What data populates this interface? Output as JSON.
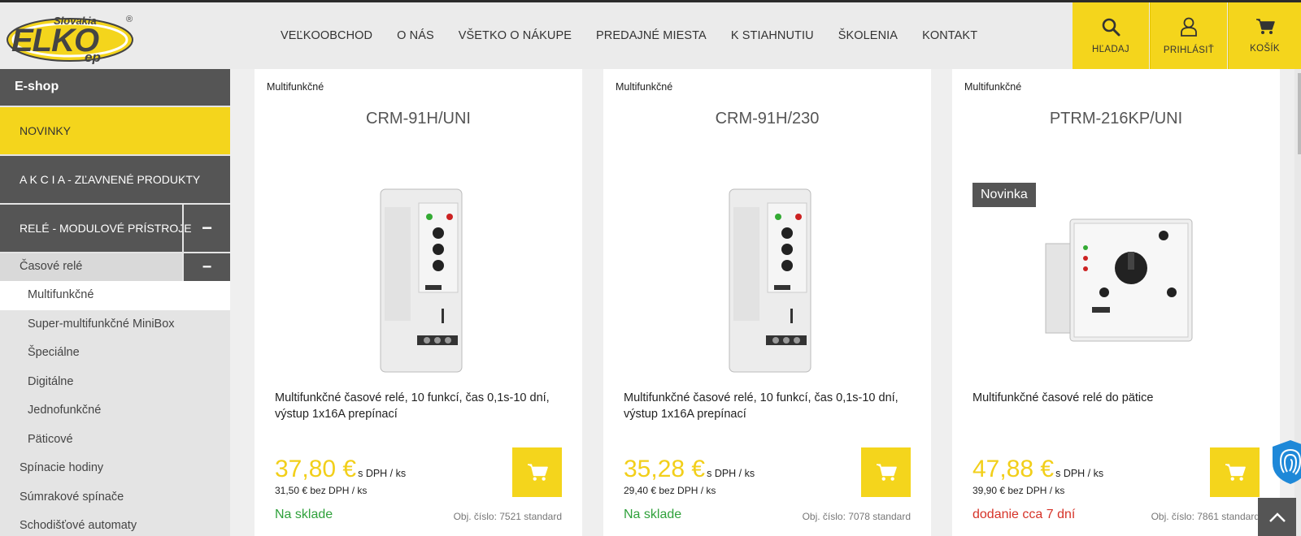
{
  "brand": {
    "logo_main": "ELKO",
    "logo_sub": "ep",
    "logo_country": "Slovakia",
    "logo_mark": "®"
  },
  "nav": [
    "VEĽKOOBCHOD",
    "O NÁS",
    "VŠETKO O NÁKUPE",
    "PREDAJNÉ MIESTA",
    "K STIAHNUTIU",
    "ŠKOLENIA",
    "KONTAKT"
  ],
  "header_buttons": {
    "search": "HĽADAJ",
    "login": "PRIHLÁSIŤ",
    "cart": "KOŠÍK"
  },
  "colors": {
    "accent": "#f4d51c",
    "dark": "#555555",
    "in_stock": "#2fa13b",
    "delayed": "#d63328"
  },
  "sidebar": {
    "title": "E-shop",
    "novinky": "NOVINKY",
    "akcia": "A K C I A - ZĽAVNENÉ PRODUKTY",
    "rele": "RELÉ - MODULOVÉ PRÍSTROJE",
    "toggle": "−",
    "sub_category": "Časové relé",
    "items": [
      "Multifunkčné",
      "Super-multifunkčné MiniBox",
      "Špeciálne",
      "Digitálne",
      "Jednofunkčné",
      "Päticové"
    ],
    "lower_items": [
      "Spínacie hodiny",
      "Súmrakové spínače",
      "Schodišťové automaty"
    ]
  },
  "products": [
    {
      "category": "Multifunkčné",
      "name": "CRM-91H/UNI",
      "badge": "",
      "description": "Multifunkčné časové relé, 10 funkcí, čas 0,1s-10 dní, výstup 1x16A prepínací",
      "price": "37,80 €",
      "price_suffix": "s DPH / ks",
      "price_net": "31,50 € bez DPH / ks",
      "stock": "Na sklade",
      "order_no": "Obj. číslo: 7521 standard"
    },
    {
      "category": "Multifunkčné",
      "name": "CRM-91H/230",
      "badge": "",
      "description": "Multifunkčné časové relé, 10 funkcí, čas 0,1s-10 dní, výstup 1x16A prepínací",
      "price": "35,28 €",
      "price_suffix": "s DPH / ks",
      "price_net": "29,40 € bez DPH / ks",
      "stock": "Na sklade",
      "order_no": "Obj. číslo: 7078 standard"
    },
    {
      "category": "Multifunkčné",
      "name": "PTRM-216KP/UNI",
      "badge": "Novinka",
      "description": "Multifunkčné časové relé do pätice",
      "price": "47,88 €",
      "price_suffix": "s DPH / ks",
      "price_net": "39,90 € bez DPH / ks",
      "stock": "dodanie cca 7 dní",
      "order_no": "Obj. číslo: 7861 standard"
    }
  ],
  "icons": {
    "search": "search-icon",
    "user": "user-icon",
    "cart": "cart-icon",
    "add_to_cart": "cart-icon",
    "fingerprint": "fingerprint-icon",
    "back_to_top": "chevron-up-icon"
  }
}
